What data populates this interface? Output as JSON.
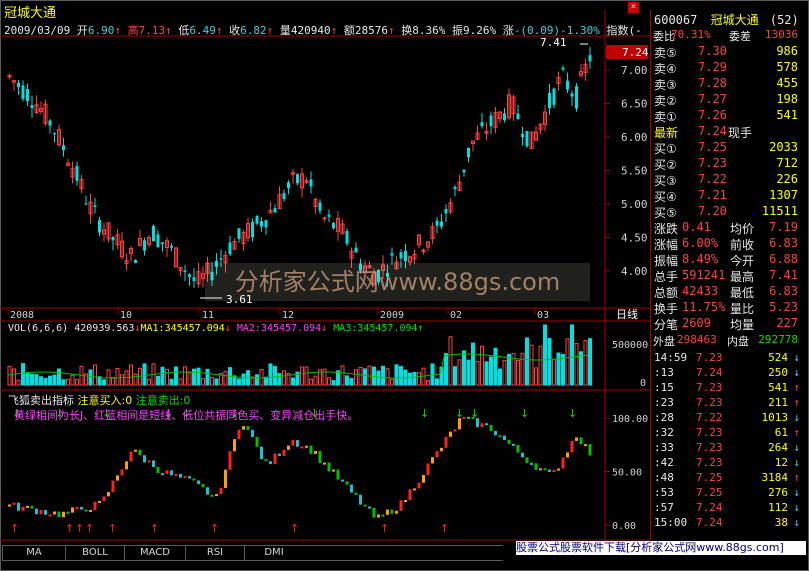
{
  "header": {
    "title": "冠城大通",
    "date": "2009/03/09",
    "open_label": "开",
    "open": "6.90",
    "high_label": "高",
    "high": "7.13",
    "low_label": "低",
    "low": "6.49",
    "close_label": "收",
    "close": "6.82",
    "vol_label": "量",
    "vol": "420940",
    "amt_label": "额",
    "amt": "28576",
    "turn_label": "换",
    "turn": "8.36%",
    "amp_label": "振",
    "amp": "9.26%",
    "chg_label": "涨",
    "chg": "-(0.09)-1.30%",
    "index_label": "指数(-",
    "close_icon": "close-icon"
  },
  "main_chart": {
    "price_ticks": [
      "7.00",
      "6.50",
      "6.00",
      "5.50",
      "5.00",
      "4.50",
      "4.00"
    ],
    "current_price": "7.24",
    "max_label": "7.41",
    "min_label": "3.61",
    "date_labels": [
      "2008",
      "10",
      "11",
      "12",
      "2009",
      "02",
      "03"
    ],
    "period_label": "日线",
    "watermark": "分析家公式网www.88gs.com"
  },
  "volume_panel": {
    "label": "VOL(6,6,6)",
    "value": "420939.563",
    "ma1": "MA1:345457.094",
    "ma2": "MA2:345457.094",
    "ma3": "MA3:345457.094",
    "ticks": [
      "500000",
      "0"
    ]
  },
  "indicator_panel": {
    "title": "飞狐卖出指标",
    "buy_text": "注意买入:0",
    "sell_text": "注意卖出:0",
    "note": "黄绿相间为长J、红蓝相间是短线、低位共振同色买、变异减仓出手快。",
    "ticks": [
      "100.00",
      "50.00",
      "0.00"
    ]
  },
  "bottom_tabs": [
    "MA",
    "BOLL",
    "MACD",
    "RSI",
    "DMI"
  ],
  "ad_text": "股票公式股票软件下载[分析家公式网www.88gs.com]",
  "quote": {
    "code": "600067",
    "name": "冠城大通",
    "count": "(52)",
    "weibi_label": "委比",
    "weibi": "70.31%",
    "weicha_label": "委差",
    "weicha": "13036",
    "asks": [
      {
        "label": "卖⑤",
        "price": "7.30",
        "vol": "986"
      },
      {
        "label": "卖④",
        "price": "7.29",
        "vol": "578"
      },
      {
        "label": "卖③",
        "price": "7.28",
        "vol": "455"
      },
      {
        "label": "卖②",
        "price": "7.27",
        "vol": "198"
      },
      {
        "label": "卖①",
        "price": "7.26",
        "vol": "541"
      }
    ],
    "latest_label": "最新",
    "latest": "7.24",
    "hand_label": "现手",
    "bids": [
      {
        "label": "买①",
        "price": "7.25",
        "vol": "2033"
      },
      {
        "label": "买②",
        "price": "7.23",
        "vol": "712"
      },
      {
        "label": "买③",
        "price": "7.22",
        "vol": "226"
      },
      {
        "label": "买④",
        "price": "7.21",
        "vol": "1307"
      },
      {
        "label": "买⑤",
        "price": "7.20",
        "vol": "11511"
      }
    ],
    "stats": [
      {
        "l1": "涨跌",
        "v1": "0.41",
        "l2": "均价",
        "v2": "7.19"
      },
      {
        "l1": "涨幅",
        "v1": "6.00%",
        "l2": "前收",
        "v2": "6.83"
      },
      {
        "l1": "振幅",
        "v1": "8.49%",
        "l2": "今开",
        "v2": "6.88"
      },
      {
        "l1": "总手",
        "v1": "591241",
        "l2": "最高",
        "v2": "7.41"
      },
      {
        "l1": "总额",
        "v1": "42433",
        "l2": "最低",
        "v2": "6.83"
      },
      {
        "l1": "换手",
        "v1": "11.75%",
        "l2": "量比",
        "v2": "5.23"
      },
      {
        "l1": "分笔",
        "v1": "2609",
        "l2": "均量",
        "v2": "227"
      }
    ],
    "outer_label": "外盘",
    "outer": "298463",
    "inner_label": "内盘",
    "inner": "292778",
    "ticks": [
      {
        "t": "14:59",
        "p": "7.23",
        "v": "524",
        "d": "↓"
      },
      {
        "t": ":13",
        "p": "7.24",
        "v": "250",
        "d": "↓"
      },
      {
        "t": ":15",
        "p": "7.23",
        "v": "541",
        "d": "↑"
      },
      {
        "t": ":23",
        "p": "7.23",
        "v": "211",
        "d": "↑"
      },
      {
        "t": ":28",
        "p": "7.22",
        "v": "1013",
        "d": "↓"
      },
      {
        "t": ":32",
        "p": "7.23",
        "v": "61",
        "d": "↑"
      },
      {
        "t": ":33",
        "p": "7.23",
        "v": "264",
        "d": "↓"
      },
      {
        "t": ":42",
        "p": "7.23",
        "v": "12",
        "d": "↓"
      },
      {
        "t": ":48",
        "p": "7.25",
        "v": "3184",
        "d": "↑"
      },
      {
        "t": ":53",
        "p": "7.25",
        "v": "276",
        "d": "↓"
      },
      {
        "t": ":57",
        "p": "7.24",
        "v": "112",
        "d": "↓"
      },
      {
        "t": "15:00",
        "p": "7.24",
        "v": "38",
        "d": "↓"
      }
    ]
  },
  "colors": {
    "up": "#ff4040",
    "down": "#00e0e0",
    "grid": "#a00000",
    "yellow": "#ffff00"
  }
}
